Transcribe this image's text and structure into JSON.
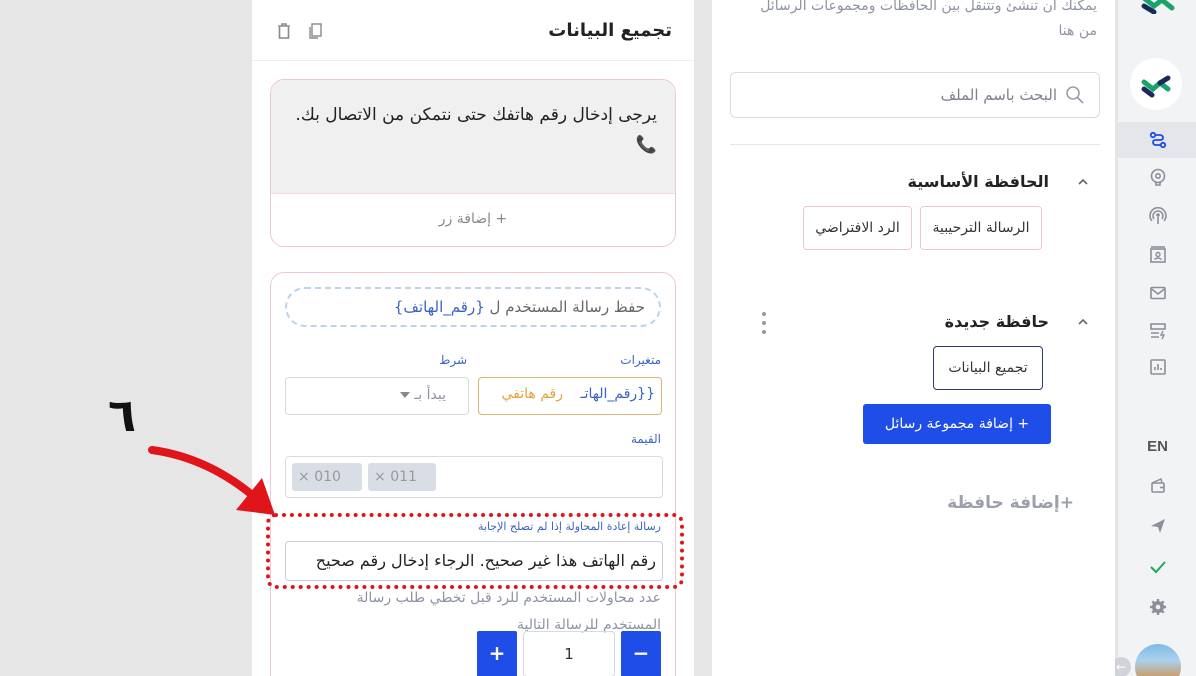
{
  "rail": {
    "lang": "EN",
    "icons": [
      "flow-icon",
      "brain-icon",
      "broadcast-icon",
      "contacts-icon",
      "mail-icon",
      "forms-icon",
      "analytics-icon",
      "wallet-icon",
      "send-icon",
      "check-icon",
      "settings-icon"
    ],
    "colors": {
      "active": "#1e4de8",
      "check": "#22a65a",
      "logo_green": "#18a36a",
      "logo_navy": "#1b2a5a"
    }
  },
  "folders": {
    "intro": "يمكنك أن تنشئ وتتنقل بين الحافظات ومجموعات الرسائل من هنا",
    "search_placeholder": "البحث باسم الملف",
    "main_folder": {
      "title": "الحافظة الأساسية",
      "chips": [
        "الرسالة الترحيبية",
        "الرد الافتراضي"
      ]
    },
    "new_folder": {
      "title": "حافظة جديدة",
      "chips": [
        "تجميع البيانات"
      ]
    },
    "add_group": "+ إضافة مجموعة رسائل",
    "add_folder": "+إضافة حافظة"
  },
  "editor": {
    "title": "تجميع البيانات",
    "message": "يرجى إدخال رقم هاتفك حتى نتمكن من الاتصال بك. 📞",
    "add_button": "+ إضافة زر",
    "save_prefix": "حفظ رسالة المستخدم ل",
    "save_var": "{رقم_الهاتف}",
    "variables_label": "متغيرات",
    "condition_label": "شرط",
    "var_value": "{{رقم_الهاتـ",
    "var_name": "رقم هاتفي",
    "condition_value": "يبدأ بـ",
    "value_label": "القيمة",
    "tags": [
      "010",
      "011"
    ],
    "retry_label": "رسالة إعادة المحاولة إذا لم تصلح الإجابة",
    "retry_value": "رقم الهاتف هذا غير صحيح. الرجاء إدخال رقم صحيح",
    "attempts_label": "عدد محاولات المستخدم للرد قبل تخطي طلب رسالة المستخدم للرسالة التالية",
    "stepper_value": "1",
    "plus": "+",
    "minus": "−"
  },
  "annotation": {
    "number": "٦",
    "color": "#e0141b"
  }
}
